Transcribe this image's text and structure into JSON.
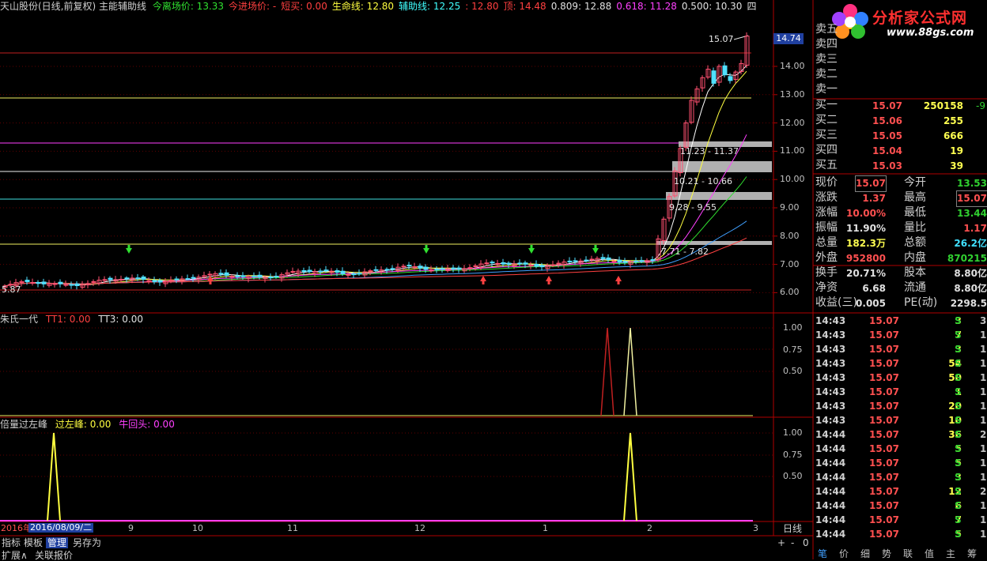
{
  "header": {
    "title": "天山股份(日线,前复权) 主能辅助线",
    "items": [
      {
        "label": "今离场价: 13.33",
        "color": "#30e030"
      },
      {
        "label": "今进场价: -",
        "color": "#ff4040"
      },
      {
        "label": "短买: 0.00",
        "color": "#ff4040"
      },
      {
        "label": "生命线: 12.80",
        "color": "#ffff40"
      },
      {
        "label": "辅助线: 12.25",
        "color": "#40ffff"
      },
      {
        "label": ": 12.80",
        "color": "#ff4040"
      },
      {
        "label": "顶: 14.48",
        "color": "#ff4040"
      },
      {
        "label": "0.809: 12.88",
        "color": "#e0e0e0"
      },
      {
        "label": "0.618: 11.28",
        "color": "#ff40ff"
      },
      {
        "label": "0.500: 10.30",
        "color": "#e0e0e0"
      },
      {
        "label": "四",
        "color": "#e0e0e0"
      }
    ]
  },
  "price_axis": {
    "labels": [
      "14.00",
      "13.00",
      "12.00",
      "11.00",
      "10.00",
      "9.00",
      "8.00",
      "7.00",
      "6.00"
    ],
    "current_tag": "14.74"
  },
  "annotations": {
    "peak": "15.07",
    "fib_a": "11.23 - 11.37",
    "fib_b": "10.21 - 10.66",
    "fib_c": "9.28 - 9.55",
    "fib_d": "7.71 - 7.82",
    "low": "5.87"
  },
  "ind1": {
    "title": "朱氏一代",
    "items": [
      {
        "label": "TT1: 0.00",
        "color": "#ff4040"
      },
      {
        "label": "TT3: 0.00",
        "color": "#e0e0e0"
      }
    ],
    "axis": [
      "1.00",
      "0.75",
      "0.50"
    ]
  },
  "ind2": {
    "title": "倍量过左峰",
    "items": [
      {
        "label": "过左峰: 0.00",
        "color": "#ffff40"
      },
      {
        "label": "牛回头: 0.00",
        "color": "#ff40ff"
      }
    ],
    "axis": [
      "1.00",
      "0.75",
      "0.50"
    ]
  },
  "date_axis": {
    "year": "2016年",
    "cursor_date": "2016/08/09/二",
    "months": [
      "9",
      "10",
      "11",
      "12",
      "1",
      "2",
      "3"
    ],
    "period": "日线"
  },
  "bottom_tabs": [
    "指标",
    "模板",
    "管理",
    "另存为"
  ],
  "bottom_tabs2": [
    "扩展∧",
    "关联报价"
  ],
  "zoom_controls": [
    "+",
    "-",
    "0"
  ],
  "logo": {
    "text": "分析家公式网",
    "url": "www.88gs.com"
  },
  "order_book": {
    "asks": [
      {
        "label": "卖五"
      },
      {
        "label": "卖四"
      },
      {
        "label": "卖三"
      },
      {
        "label": "卖二"
      },
      {
        "label": "卖一"
      }
    ],
    "bids": [
      {
        "label": "买一",
        "price": "15.07",
        "vol": "250158",
        "extra": "-9"
      },
      {
        "label": "买二",
        "price": "15.06",
        "vol": "255",
        "extra": ""
      },
      {
        "label": "买三",
        "price": "15.05",
        "vol": "666",
        "extra": ""
      },
      {
        "label": "买四",
        "price": "15.04",
        "vol": "19",
        "extra": ""
      },
      {
        "label": "买五",
        "price": "15.03",
        "vol": "39",
        "extra": ""
      }
    ]
  },
  "stats": [
    {
      "l1": "现价",
      "v1": "15.07",
      "c1": "#ff5050",
      "l2": "今开",
      "v2": "13.53",
      "c2": "#30d030"
    },
    {
      "l1": "涨跌",
      "v1": "1.37",
      "c1": "#ff5050",
      "l2": "最高",
      "v2": "15.07",
      "c2": "#ff5050"
    },
    {
      "l1": "涨幅",
      "v1": "10.00%",
      "c1": "#ff5050",
      "l2": "最低",
      "v2": "13.44",
      "c2": "#30d030"
    },
    {
      "l1": "振幅",
      "v1": "11.90%",
      "c1": "#e0e0e0",
      "l2": "量比",
      "v2": "1.17",
      "c2": "#ff5050"
    },
    {
      "l1": "总量",
      "v1": "182.3万",
      "c1": "#ffff50",
      "l2": "总额",
      "v2": "26.2亿",
      "c2": "#40e0ff"
    },
    {
      "l1": "外盘",
      "v1": "952800",
      "c1": "#ff5050",
      "l2": "内盘",
      "v2": "870215",
      "c2": "#30d030"
    },
    {
      "l1": "换手",
      "v1": "20.71%",
      "c1": "#e0e0e0",
      "l2": "股本",
      "v2": "8.80亿",
      "c2": "#e0e0e0"
    },
    {
      "l1": "净资",
      "v1": "6.68",
      "c1": "#e0e0e0",
      "l2": "流通",
      "v2": "8.80亿",
      "c2": "#e0e0e0"
    },
    {
      "l1": "收益(三)",
      "v1": "0.005",
      "c1": "#e0e0e0",
      "l2": "PE(动)",
      "v2": "2298.5",
      "c2": "#e0e0e0"
    }
  ],
  "ticks": [
    {
      "t": "14:43",
      "p": "15.07",
      "q": "3",
      "s": "S",
      "c": "3"
    },
    {
      "t": "14:43",
      "p": "15.07",
      "q": "7",
      "s": "S",
      "c": "1"
    },
    {
      "t": "14:43",
      "p": "15.07",
      "q": "3",
      "s": "S",
      "c": "1"
    },
    {
      "t": "14:43",
      "p": "15.07",
      "q": "54",
      "s": "S",
      "c": "1"
    },
    {
      "t": "14:43",
      "p": "15.07",
      "q": "50",
      "s": "S",
      "c": "1"
    },
    {
      "t": "14:43",
      "p": "15.07",
      "q": "1",
      "s": "S",
      "c": "1"
    },
    {
      "t": "14:43",
      "p": "15.07",
      "q": "20",
      "s": "S",
      "c": "1"
    },
    {
      "t": "14:43",
      "p": "15.07",
      "q": "10",
      "s": "S",
      "c": "1"
    },
    {
      "t": "14:44",
      "p": "15.07",
      "q": "36",
      "s": "S",
      "c": "2"
    },
    {
      "t": "14:44",
      "p": "15.07",
      "q": "5",
      "s": "S",
      "c": "1"
    },
    {
      "t": "14:44",
      "p": "15.07",
      "q": "5",
      "s": "S",
      "c": "1"
    },
    {
      "t": "14:44",
      "p": "15.07",
      "q": "3",
      "s": "S",
      "c": "1"
    },
    {
      "t": "14:44",
      "p": "15.07",
      "q": "12",
      "s": "S",
      "c": "2"
    },
    {
      "t": "14:44",
      "p": "15.07",
      "q": "6",
      "s": "S",
      "c": "1"
    },
    {
      "t": "14:44",
      "p": "15.07",
      "q": "7",
      "s": "S",
      "c": "1"
    },
    {
      "t": "14:44",
      "p": "15.07",
      "q": "5",
      "s": "S",
      "c": "1"
    }
  ],
  "right_tabs": [
    "笔",
    "价",
    "细",
    "势",
    "联",
    "值",
    "主",
    "筹"
  ]
}
